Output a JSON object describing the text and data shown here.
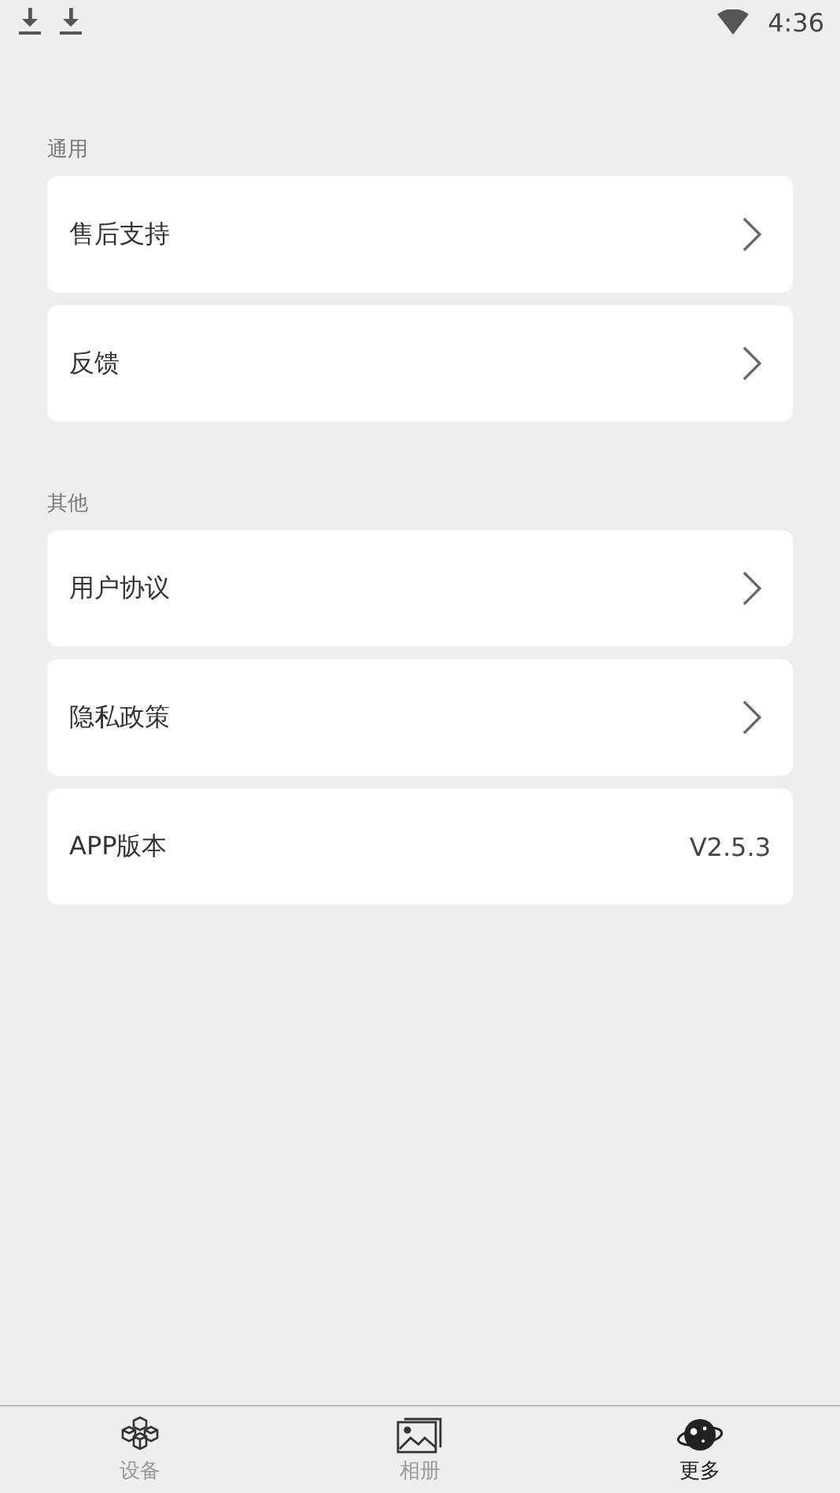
{
  "status_bar": {
    "time": "4:36"
  },
  "sections": [
    {
      "title": "通用",
      "items": [
        {
          "kind": "link",
          "label": "售后支持"
        },
        {
          "kind": "link",
          "label": "反馈"
        }
      ]
    },
    {
      "title": "其他",
      "items": [
        {
          "kind": "link",
          "label": "用户协议"
        },
        {
          "kind": "link",
          "label": "隐私政策"
        },
        {
          "kind": "value",
          "label": "APP版本",
          "value": "V2.5.3"
        }
      ]
    }
  ],
  "tabs": [
    {
      "kind": "devices",
      "label": "设备",
      "selected": false
    },
    {
      "kind": "album",
      "label": "相册",
      "selected": false
    },
    {
      "kind": "more",
      "label": "更多",
      "selected": true
    }
  ]
}
